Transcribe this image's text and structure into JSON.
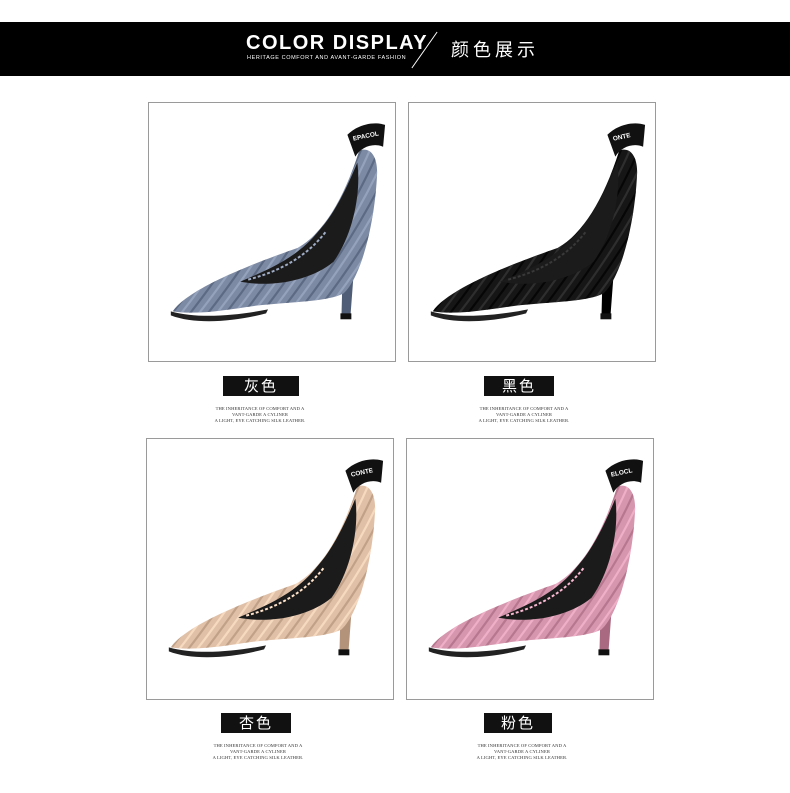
{
  "header": {
    "title": "COLOR DISPLAY",
    "subtitle": "HERITAGE COMFORT AND AVANT-GARDE FASHION",
    "title_cn": "颜色展示"
  },
  "products": [
    {
      "label": "灰色",
      "caption": [
        "THE INHERITANCE OF COMFORT AND A",
        "VANT-GARDE A CYLINER",
        "A LIGHT, EYE CATCHING SILK LEATHER."
      ],
      "shoe_color": "#7d8aa3",
      "strap_text": "EPACOL"
    },
    {
      "label": "黑色",
      "caption": [
        "THE INHERITANCE OF COMFORT AND A",
        "VANT-GARDE A CYLINER",
        "A LIGHT, EYE CATCHING SILK LEATHER."
      ],
      "shoe_color": "#161616",
      "strap_text": "ONTE"
    },
    {
      "label": "杏色",
      "caption": [
        "THE INHERITANCE OF COMFORT AND A",
        "VANT-GARDE A CYLINER",
        "A LIGHT, EYE CATCHING SILK LEATHER."
      ],
      "shoe_color": "#e0c1a8",
      "strap_text": "CONTE"
    },
    {
      "label": "粉色",
      "caption": [
        "THE INHERITANCE OF COMFORT AND A",
        "VANT-GARDE A CYLINER",
        "A LIGHT, EYE CATCHING SILK LEATHER."
      ],
      "shoe_color": "#d596ae",
      "strap_text": "ELOCL"
    }
  ]
}
